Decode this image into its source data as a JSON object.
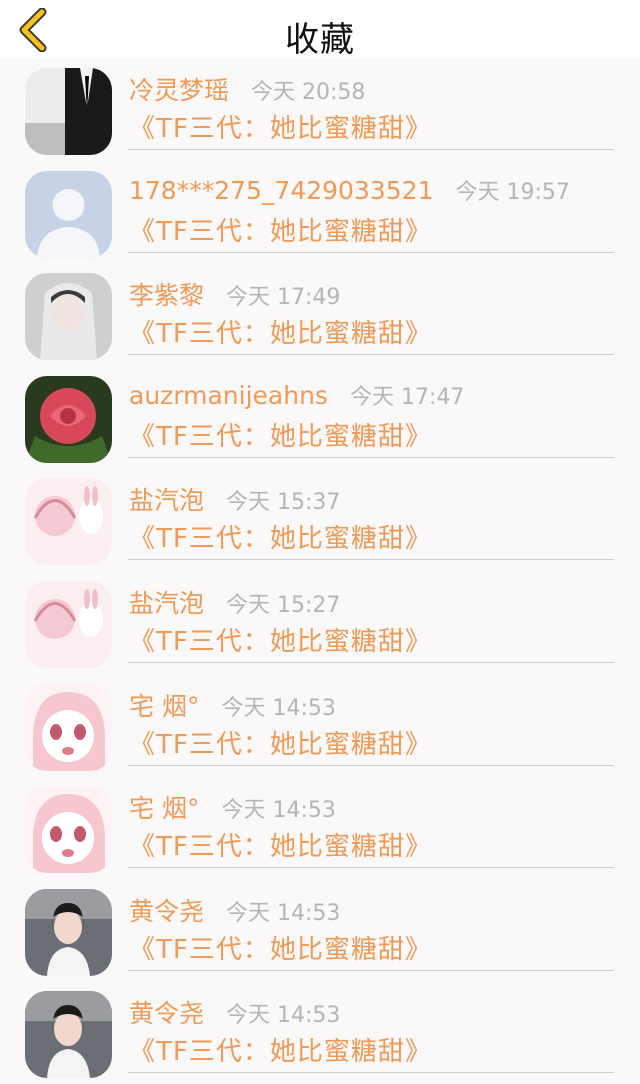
{
  "header": {
    "title": "收藏",
    "back_icon": "chevron-left-icon",
    "accent": "#f7c21b"
  },
  "colors": {
    "name": "#f19a55",
    "time": "#b5b5b5",
    "separator": "#cfcfcf"
  },
  "items": [
    {
      "name": "冷灵梦瑶",
      "time": "今天 20:58",
      "book": "《TF三代：她比蜜糖甜》",
      "avatar": "dark-portrait"
    },
    {
      "name": "178***275_7429033521",
      "time": "今天 19:57",
      "book": "《TF三代：她比蜜糖甜》",
      "avatar": "default-user"
    },
    {
      "name": "李紫黎",
      "time": "今天 17:49",
      "book": "《TF三代：她比蜜糖甜》",
      "avatar": "girl-portrait"
    },
    {
      "name": "auzrmanijeahns",
      "time": "今天 17:47",
      "book": "《TF三代：她比蜜糖甜》",
      "avatar": "rose"
    },
    {
      "name": "盐汽泡",
      "time": "今天 15:37",
      "book": "《TF三代：她比蜜糖甜》",
      "avatar": "anime-pink"
    },
    {
      "name": "盐汽泡",
      "time": "今天 15:27",
      "book": "《TF三代：她比蜜糖甜》",
      "avatar": "anime-pink"
    },
    {
      "name": "宅 烟°",
      "time": "今天 14:53",
      "book": "《TF三代：她比蜜糖甜》",
      "avatar": "anime-face"
    },
    {
      "name": "宅 烟°",
      "time": "今天 14:53",
      "book": "《TF三代：她比蜜糖甜》",
      "avatar": "anime-face"
    },
    {
      "name": "黄令尧",
      "time": "今天 14:53",
      "book": "《TF三代：她比蜜糖甜》",
      "avatar": "girl-white"
    },
    {
      "name": "黄令尧",
      "time": "今天 14:53",
      "book": "《TF三代：她比蜜糖甜》",
      "avatar": "girl-white"
    }
  ]
}
